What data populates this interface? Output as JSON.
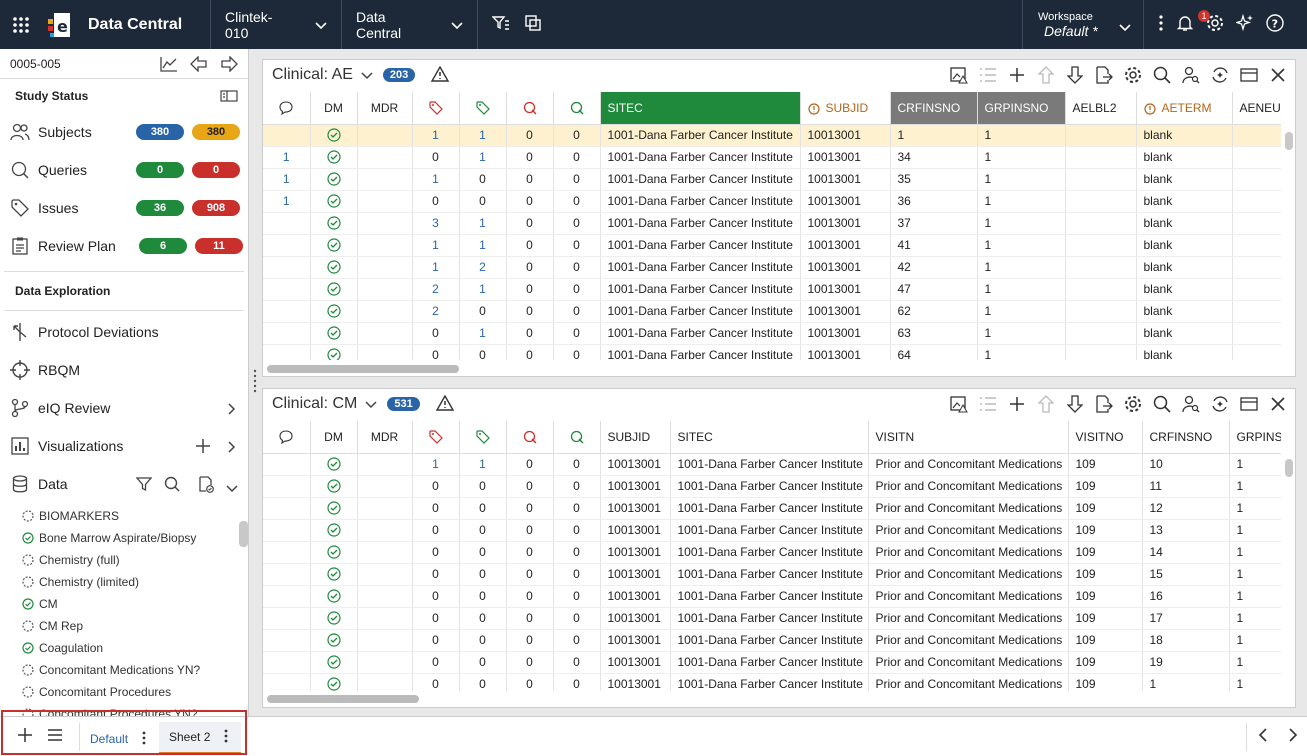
{
  "topbar": {
    "app_title": "Data Central",
    "study": "Clintek-010",
    "module": "Data Central",
    "workspace_label": "Workspace",
    "workspace_value": "Default",
    "workspace_dirty": "*",
    "notification_count": "1"
  },
  "sidebar": {
    "record_id": "0005-005",
    "study_status_title": "Study Status",
    "status_items": [
      {
        "label": "Subjects",
        "a": "380",
        "b": "380",
        "a_color": "#2a64a8",
        "b_color": "#e8a515"
      },
      {
        "label": "Queries",
        "a": "0",
        "b": "0",
        "a_color": "#1f8a3c",
        "b_color": "#c9302c"
      },
      {
        "label": "Issues",
        "a": "36",
        "b": "908",
        "a_color": "#1f8a3c",
        "b_color": "#c9302c"
      },
      {
        "label": "Review Plan",
        "a": "6",
        "b": "11",
        "a_color": "#1f8a3c",
        "b_color": "#c9302c"
      }
    ],
    "exploration_title": "Data Exploration",
    "exploration_items": [
      "Protocol Deviations",
      "RBQM",
      "eIQ Review",
      "Visualizations",
      "Data"
    ],
    "datasets": [
      {
        "name": "BIOMARKERS",
        "done": false
      },
      {
        "name": "Bone Marrow Aspirate/Biopsy",
        "done": true
      },
      {
        "name": "Chemistry (full)",
        "done": false
      },
      {
        "name": "Chemistry (limited)",
        "done": false
      },
      {
        "name": "CM",
        "done": true
      },
      {
        "name": "CM Rep",
        "done": false
      },
      {
        "name": "Coagulation",
        "done": true
      },
      {
        "name": "Concomitant Medications YN?",
        "done": false
      },
      {
        "name": "Concomitant Procedures",
        "done": false
      },
      {
        "name": "Concomitant Procedures YN?",
        "done": false
      }
    ]
  },
  "panel_ae": {
    "title": "Clinical: AE",
    "count": "203",
    "headers": [
      "",
      "DM",
      "MDR",
      "",
      "",
      "Q",
      "Q",
      "SITEC",
      "SUBJID",
      "CRFINSNO",
      "GRPINSNO",
      "AELBL2",
      "AETERM",
      "AENEUR"
    ],
    "rows": [
      [
        "",
        "",
        "",
        "1",
        "1",
        "0",
        "0",
        "1001-Dana Farber Cancer Institute",
        "10013001",
        "1",
        "1",
        "",
        "blank"
      ],
      [
        "1",
        "",
        "",
        "0",
        "1",
        "0",
        "0",
        "1001-Dana Farber Cancer Institute",
        "10013001",
        "34",
        "1",
        "",
        "blank"
      ],
      [
        "1",
        "",
        "",
        "1",
        "0",
        "0",
        "0",
        "1001-Dana Farber Cancer Institute",
        "10013001",
        "35",
        "1",
        "",
        "blank"
      ],
      [
        "1",
        "",
        "",
        "0",
        "0",
        "0",
        "0",
        "1001-Dana Farber Cancer Institute",
        "10013001",
        "36",
        "1",
        "",
        "blank"
      ],
      [
        "",
        "",
        "",
        "3",
        "1",
        "0",
        "0",
        "1001-Dana Farber Cancer Institute",
        "10013001",
        "37",
        "1",
        "",
        "blank"
      ],
      [
        "",
        "",
        "",
        "1",
        "1",
        "0",
        "0",
        "1001-Dana Farber Cancer Institute",
        "10013001",
        "41",
        "1",
        "",
        "blank"
      ],
      [
        "",
        "",
        "",
        "1",
        "2",
        "0",
        "0",
        "1001-Dana Farber Cancer Institute",
        "10013001",
        "42",
        "1",
        "",
        "blank"
      ],
      [
        "",
        "",
        "",
        "2",
        "1",
        "0",
        "0",
        "1001-Dana Farber Cancer Institute",
        "10013001",
        "47",
        "1",
        "",
        "blank"
      ],
      [
        "",
        "",
        "",
        "2",
        "0",
        "0",
        "0",
        "1001-Dana Farber Cancer Institute",
        "10013001",
        "62",
        "1",
        "",
        "blank"
      ],
      [
        "",
        "",
        "",
        "0",
        "1",
        "0",
        "0",
        "1001-Dana Farber Cancer Institute",
        "10013001",
        "63",
        "1",
        "",
        "blank"
      ],
      [
        "",
        "",
        "",
        "0",
        "0",
        "0",
        "0",
        "1001-Dana Farber Cancer Institute",
        "10013001",
        "64",
        "1",
        "",
        "blank"
      ]
    ]
  },
  "panel_cm": {
    "title": "Clinical: CM",
    "count": "531",
    "headers": [
      "",
      "DM",
      "MDR",
      "",
      "",
      "Q",
      "Q",
      "SUBJID",
      "SITEC",
      "VISITN",
      "VISITNO",
      "CRFINSNO",
      "GRPINSNO"
    ],
    "rows": [
      [
        "",
        "",
        "",
        "1",
        "1",
        "0",
        "0",
        "10013001",
        "1001-Dana Farber Cancer Institute",
        "Prior and Concomitant Medications",
        "109",
        "10",
        "1"
      ],
      [
        "",
        "",
        "",
        "0",
        "0",
        "0",
        "0",
        "10013001",
        "1001-Dana Farber Cancer Institute",
        "Prior and Concomitant Medications",
        "109",
        "11",
        "1"
      ],
      [
        "",
        "",
        "",
        "0",
        "0",
        "0",
        "0",
        "10013001",
        "1001-Dana Farber Cancer Institute",
        "Prior and Concomitant Medications",
        "109",
        "12",
        "1"
      ],
      [
        "",
        "",
        "",
        "0",
        "0",
        "0",
        "0",
        "10013001",
        "1001-Dana Farber Cancer Institute",
        "Prior and Concomitant Medications",
        "109",
        "13",
        "1"
      ],
      [
        "",
        "",
        "",
        "0",
        "0",
        "0",
        "0",
        "10013001",
        "1001-Dana Farber Cancer Institute",
        "Prior and Concomitant Medications",
        "109",
        "14",
        "1"
      ],
      [
        "",
        "",
        "",
        "0",
        "0",
        "0",
        "0",
        "10013001",
        "1001-Dana Farber Cancer Institute",
        "Prior and Concomitant Medications",
        "109",
        "15",
        "1"
      ],
      [
        "",
        "",
        "",
        "0",
        "0",
        "0",
        "0",
        "10013001",
        "1001-Dana Farber Cancer Institute",
        "Prior and Concomitant Medications",
        "109",
        "16",
        "1"
      ],
      [
        "",
        "",
        "",
        "0",
        "0",
        "0",
        "0",
        "10013001",
        "1001-Dana Farber Cancer Institute",
        "Prior and Concomitant Medications",
        "109",
        "17",
        "1"
      ],
      [
        "",
        "",
        "",
        "0",
        "0",
        "0",
        "0",
        "10013001",
        "1001-Dana Farber Cancer Institute",
        "Prior and Concomitant Medications",
        "109",
        "18",
        "1"
      ],
      [
        "",
        "",
        "",
        "0",
        "0",
        "0",
        "0",
        "10013001",
        "1001-Dana Farber Cancer Institute",
        "Prior and Concomitant Medications",
        "109",
        "19",
        "1"
      ],
      [
        "",
        "",
        "",
        "0",
        "0",
        "0",
        "0",
        "10013001",
        "1001-Dana Farber Cancer Institute",
        "Prior and Concomitant Medications",
        "109",
        "1",
        "1"
      ]
    ]
  },
  "bottombar": {
    "tabs": [
      "Default",
      "Sheet 2"
    ],
    "active_tab": "Sheet 2"
  },
  "colors": {
    "nav": "#1d2939",
    "accent": "#2a64a8",
    "green": "#1f8a3c",
    "red": "#c9302c",
    "highlight": "#fdf1cf",
    "sitec_header": "#1f8a3c"
  }
}
